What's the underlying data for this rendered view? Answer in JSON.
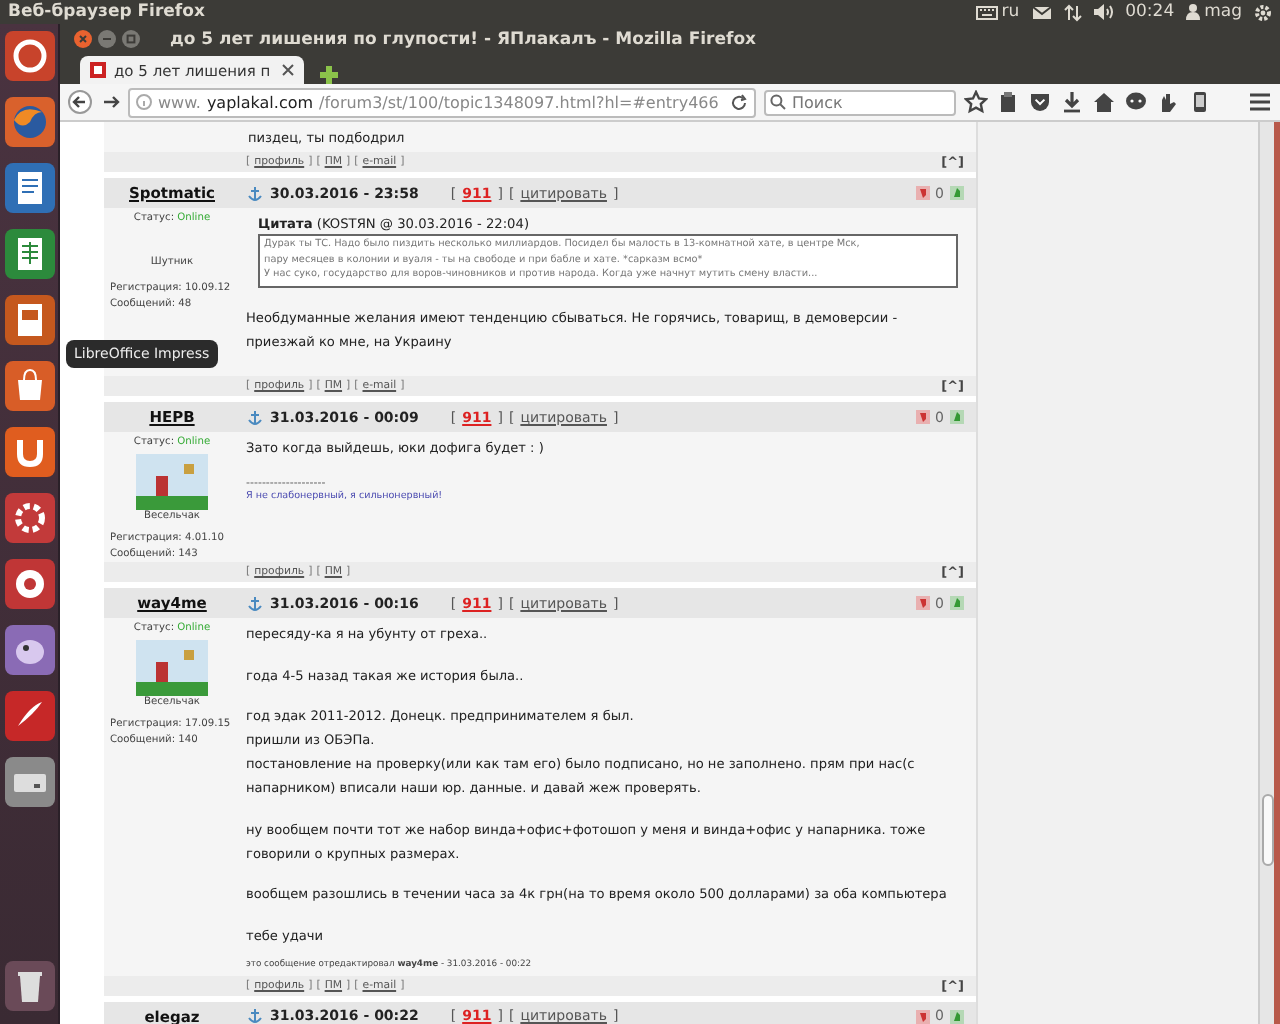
{
  "panel": {
    "app_title": "Веб-браузер Firefox",
    "keyboard": "ru",
    "time": "00:24",
    "user": "mag"
  },
  "launcher": {
    "tooltip": "LibreOffice Impress"
  },
  "window": {
    "title": "до 5 лет лишения по глупости! - ЯПлакалъ - Mozilla Firefox"
  },
  "tabs": [
    {
      "label": "до 5 лет лишения п",
      "selected": true
    }
  ],
  "address": {
    "prefix": "www.",
    "domain": "yaplakal.com",
    "path": "/forum3/st/100/topic1348097.html?hl=#entry466"
  },
  "search": {
    "placeholder": "Поиск"
  },
  "posts": [
    {
      "kind": "tail",
      "body": [
        {
          "kind": "text",
          "lines": [
            "пиздец, ты подбодрил"
          ]
        }
      ],
      "footer": [
        {
          "open": "[",
          "label": "профиль",
          "close": "]"
        },
        {
          "open": "[",
          "label": "ПМ",
          "close": "]"
        },
        {
          "open": "[",
          "label": "e-mail",
          "close": "]"
        }
      ],
      "top": "[^]"
    },
    {
      "kind": "full",
      "author": "Spotmatic",
      "date": "30.03.2016 - 23:58",
      "actions": [
        {
          "open": "[",
          "label": "911",
          "close": "]",
          "kind": "alert"
        },
        {
          "open": "[",
          "label": "цитировать",
          "close": "]",
          "kind": "link"
        }
      ],
      "votes": "0",
      "status_label": "Статус:",
      "status": "Online",
      "rank": "Шутник",
      "registration": "Регистрация: 10.09.12",
      "messages": "Сообщений: 48",
      "body": [
        {
          "kind": "quote",
          "title": "Цитата",
          "meta": "(KOSTЯN @ 30.03.2016 - 22:04)",
          "lines": [
            "Дурак ты ТС. Надо было пиздить несколько миллиардов. Посидел бы малость в 13-комнатной хате, в центре Мск,",
            "пару месяцев в колонии и вуаля - ты на свободе и при бабле и хате. *сарказм всмо*",
            "У нас суко, государство для воров-чиновников и против народа. Когда уже начнут мутить смену власти..."
          ]
        },
        {
          "kind": "text",
          "lines": [
            "Необдуманные желания имеют тенденцию сбываться. Не горячись, товарищ, в демоверсии - приезжай ко мне, на Украину"
          ]
        }
      ],
      "footer": [
        {
          "open": "[",
          "label": "профиль",
          "close": "]"
        },
        {
          "open": "[",
          "label": "ПМ",
          "close": "]"
        },
        {
          "open": "[",
          "label": "e-mail",
          "close": "]"
        }
      ],
      "top": "[^]"
    },
    {
      "kind": "full",
      "author": "HEPB",
      "date": "31.03.2016 - 00:09",
      "actions": [
        {
          "open": "[",
          "label": "911",
          "close": "]",
          "kind": "alert"
        },
        {
          "open": "[",
          "label": "цитировать",
          "close": "]",
          "kind": "link"
        }
      ],
      "votes": "0",
      "status_label": "Статус:",
      "status": "Online",
      "avatar": true,
      "rank": "Весельчак",
      "registration": "Регистрация: 4.01.10",
      "messages": "Сообщений: 143",
      "body": [
        {
          "kind": "text",
          "lines": [
            "Зато когда выйдешь, юки дофига будет : )"
          ]
        },
        {
          "kind": "rule",
          "text": "--------------------"
        },
        {
          "kind": "signature",
          "text": "Я не слабонервный, я сильнонервный!"
        }
      ],
      "footer": [
        {
          "open": "[",
          "label": "профиль",
          "close": "]"
        },
        {
          "open": "[",
          "label": "ПМ",
          "close": "]"
        }
      ],
      "top": "[^]"
    },
    {
      "kind": "full",
      "author": "way4me",
      "date": "31.03.2016 - 00:16",
      "actions": [
        {
          "open": "[",
          "label": "911",
          "close": "]",
          "kind": "alert"
        },
        {
          "open": "[",
          "label": "цитировать",
          "close": "]",
          "kind": "link"
        }
      ],
      "votes": "0",
      "status_label": "Статус:",
      "status": "Online",
      "avatar": true,
      "rank": "Весельчак",
      "registration": "Регистрация: 17.09.15",
      "messages": "Сообщений: 140",
      "body": [
        {
          "kind": "text",
          "lines": [
            "пересяду-ка я на убунту от греха.."
          ]
        },
        {
          "kind": "text",
          "lines": [
            "года 4-5 назад такая же история была.."
          ]
        },
        {
          "kind": "text",
          "lines": [
            "год эдак 2011-2012. Донецк. предпринимателем я был.",
            "пришли из ОБЭПа.",
            "постановление на проверку(или как там его) было подписано, но не заполнено. прям при нас(с напарником) вписали наши юр. данные. и давай жеж проверять."
          ]
        },
        {
          "kind": "text",
          "lines": [
            "ну вообщем почти тот же набор винда+офис+фотошоп у меня и винда+офис у напарника. тоже говорили о крупных размерах."
          ]
        },
        {
          "kind": "text",
          "lines": [
            "вообщем разошлись в течении часа за 4к грн(на то время около 500 долларами) за оба компьютера"
          ]
        },
        {
          "kind": "text",
          "lines": [
            "тебе удачи"
          ]
        },
        {
          "kind": "edit",
          "text": "это сообщение отредактировал **way4me** - 31.03.2016 - 00:22"
        }
      ],
      "footer": [
        {
          "open": "[",
          "label": "профиль",
          "close": "]"
        },
        {
          "open": "[",
          "label": "ПМ",
          "close": "]"
        },
        {
          "open": "[",
          "label": "e-mail",
          "close": "]"
        }
      ],
      "top": "[^]"
    },
    {
      "kind": "head",
      "author": "elegaz",
      "date": "31.03.2016 - 00:22",
      "actions": [
        {
          "open": "[",
          "label": "911",
          "close": "]",
          "kind": "alert"
        },
        {
          "open": "[",
          "label": "цитировать",
          "close": "]",
          "kind": "link"
        }
      ],
      "votes": "0"
    }
  ]
}
